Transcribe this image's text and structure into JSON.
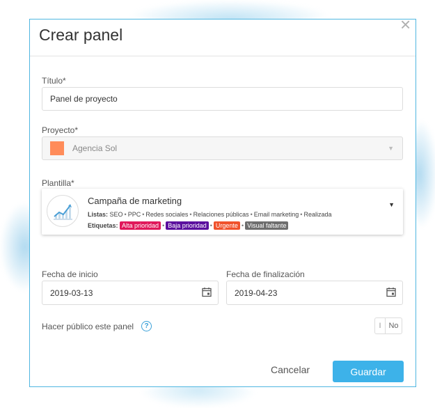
{
  "dialog": {
    "title": "Crear panel",
    "close_glyph": "×"
  },
  "titulo": {
    "label": "Título*",
    "value": "Panel de proyecto"
  },
  "proyecto": {
    "label": "Proyecto*",
    "value": "Agencia Sol",
    "color": "#ff8c5a"
  },
  "plantilla": {
    "label": "Plantilla*",
    "name": "Campaña de marketing",
    "lists_label": "Listas:",
    "lists": [
      "SEO",
      "PPC",
      "Redes sociales",
      "Relaciones públicas",
      "Email marketing",
      "Realizada"
    ],
    "tags_label": "Etiquetas:",
    "tags": [
      {
        "label": "Alta prioridad",
        "color": "#e0185a"
      },
      {
        "label": "Baja prioridad",
        "color": "#5b0f9e"
      },
      {
        "label": "Urgente",
        "color": "#f0522c"
      },
      {
        "label": "Visual faltante",
        "color": "#6e6e6e"
      }
    ]
  },
  "fecha_inicio": {
    "label": "Fecha de inicio",
    "value": "2019-03-13"
  },
  "fecha_fin": {
    "label": "Fecha de finalización",
    "value": "2019-04-23"
  },
  "publico": {
    "label": "Hacer público este panel",
    "help": "?",
    "toggle_on": "I",
    "toggle_off": "No"
  },
  "actions": {
    "cancel": "Cancelar",
    "save": "Guardar"
  },
  "colors": {
    "accent": "#3db2e9",
    "border": "#4fb6e0"
  }
}
